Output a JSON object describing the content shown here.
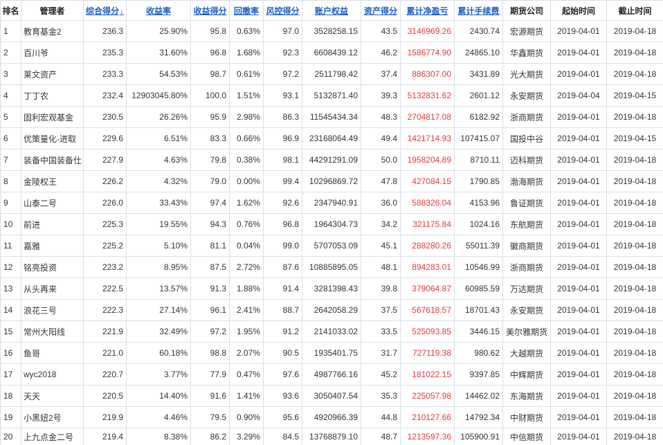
{
  "colors": {
    "text": "#333333",
    "header_text": "#222222",
    "link": "#1a5fc8",
    "sort_arrow": "#e4393c",
    "net_pnl": "#e4393c",
    "grid": "#d8dfe9",
    "background": "#ffffff"
  },
  "table": {
    "headers": {
      "rank": "排名",
      "manager": "管理者",
      "score": "综合得分",
      "return_rate": "收益率",
      "return_score": "收益得分",
      "drawdown": "回撤率",
      "risk_score": "风控得分",
      "equity": "账户权益",
      "asset_score": "资产得分",
      "net_pnl": "累计净盈亏",
      "fees": "累计手续费",
      "broker": "期货公司",
      "start_date": "起始时间",
      "end_date": "截止时间"
    },
    "sort_indicator": "↓",
    "rows": [
      {
        "rank": "1",
        "manager": "教育基金2",
        "score": "236.3",
        "return_rate": "25.90%",
        "return_score": "95.8",
        "drawdown": "0.63%",
        "risk_score": "97.0",
        "equity": "3528258.15",
        "asset_score": "43.5",
        "net_pnl": "3146969.26",
        "fees": "2430.74",
        "broker": "宏源期货",
        "start_date": "2019-04-01",
        "end_date": "2019-04-18"
      },
      {
        "rank": "2",
        "manager": "百川爷",
        "score": "235.3",
        "return_rate": "31.60%",
        "return_score": "96.8",
        "drawdown": "1.68%",
        "risk_score": "92.3",
        "equity": "6608439.12",
        "asset_score": "46.2",
        "net_pnl": "1586774.90",
        "fees": "24865.10",
        "broker": "华鑫期货",
        "start_date": "2019-04-01",
        "end_date": "2019-04-18"
      },
      {
        "rank": "3",
        "manager": "莱文资产",
        "score": "233.3",
        "return_rate": "54.53%",
        "return_score": "98.7",
        "drawdown": "0.61%",
        "risk_score": "97.2",
        "equity": "2511798.42",
        "asset_score": "37.4",
        "net_pnl": "886307.00",
        "fees": "3431.89",
        "broker": "光大期货",
        "start_date": "2019-04-01",
        "end_date": "2019-04-18"
      },
      {
        "rank": "4",
        "manager": "丁丁农",
        "score": "232.4",
        "return_rate": "12903045.80%",
        "return_score": "100.0",
        "drawdown": "1.51%",
        "risk_score": "93.1",
        "equity": "5132871.40",
        "asset_score": "39.3",
        "net_pnl": "5132831.62",
        "fees": "2601.12",
        "broker": "永安期货",
        "start_date": "2019-04-04",
        "end_date": "2019-04-15"
      },
      {
        "rank": "5",
        "manager": "固利宏观基金",
        "score": "230.5",
        "return_rate": "26.26%",
        "return_score": "95.9",
        "drawdown": "2.98%",
        "risk_score": "86.3",
        "equity": "11545434.34",
        "asset_score": "48.3",
        "net_pnl": "2704817.08",
        "fees": "6182.92",
        "broker": "浙商期货",
        "start_date": "2019-04-01",
        "end_date": "2019-04-18"
      },
      {
        "rank": "6",
        "manager": "优策量化-进取",
        "score": "229.6",
        "return_rate": "6.51%",
        "return_score": "83.3",
        "drawdown": "0.66%",
        "risk_score": "96.9",
        "equity": "23168064.49",
        "asset_score": "49.4",
        "net_pnl": "1421714.93",
        "fees": "107415.07",
        "broker": "国投中谷",
        "start_date": "2019-04-01",
        "end_date": "2019-04-15"
      },
      {
        "rank": "7",
        "manager": "装备中国装备仕",
        "score": "227.9",
        "return_rate": "4.63%",
        "return_score": "79.8",
        "drawdown": "0.38%",
        "risk_score": "98.1",
        "equity": "44291291.09",
        "asset_score": "50.0",
        "net_pnl": "1958204.89",
        "fees": "8710.11",
        "broker": "迈科期货",
        "start_date": "2019-04-01",
        "end_date": "2019-04-18"
      },
      {
        "rank": "8",
        "manager": "金陵权王",
        "score": "226.2",
        "return_rate": "4.32%",
        "return_score": "79.0",
        "drawdown": "0.00%",
        "risk_score": "99.4",
        "equity": "10296869.72",
        "asset_score": "47.8",
        "net_pnl": "427084.15",
        "fees": "1790.85",
        "broker": "渤海期货",
        "start_date": "2019-04-01",
        "end_date": "2019-04-18"
      },
      {
        "rank": "9",
        "manager": "山泰二号",
        "score": "226.0",
        "return_rate": "33.43%",
        "return_score": "97.4",
        "drawdown": "1.62%",
        "risk_score": "92.6",
        "equity": "2347940.91",
        "asset_score": "36.0",
        "net_pnl": "588326.04",
        "fees": "4153.96",
        "broker": "鲁证期货",
        "start_date": "2019-04-01",
        "end_date": "2019-04-18"
      },
      {
        "rank": "10",
        "manager": "前进",
        "score": "225.3",
        "return_rate": "19.55%",
        "return_score": "94.3",
        "drawdown": "0.76%",
        "risk_score": "96.8",
        "equity": "1964304.73",
        "asset_score": "34.2",
        "net_pnl": "321175.84",
        "fees": "1024.16",
        "broker": "东航期货",
        "start_date": "2019-04-01",
        "end_date": "2019-04-18"
      },
      {
        "rank": "11",
        "manager": "嘉雅",
        "score": "225.2",
        "return_rate": "5.10%",
        "return_score": "81.1",
        "drawdown": "0.04%",
        "risk_score": "99.0",
        "equity": "5707053.09",
        "asset_score": "45.1",
        "net_pnl": "288280.26",
        "fees": "55011.39",
        "broker": "徽商期货",
        "start_date": "2019-04-01",
        "end_date": "2019-04-18"
      },
      {
        "rank": "12",
        "manager": "铭亮投资",
        "score": "223.2",
        "return_rate": "8.95%",
        "return_score": "87.5",
        "drawdown": "2.72%",
        "risk_score": "87.6",
        "equity": "10885895.05",
        "asset_score": "48.1",
        "net_pnl": "894283.01",
        "fees": "10546.99",
        "broker": "浙商期货",
        "start_date": "2019-04-01",
        "end_date": "2019-04-18"
      },
      {
        "rank": "13",
        "manager": "从头再来",
        "score": "222.5",
        "return_rate": "13.57%",
        "return_score": "91.3",
        "drawdown": "1.88%",
        "risk_score": "91.4",
        "equity": "3281398.43",
        "asset_score": "39.8",
        "net_pnl": "379064.87",
        "fees": "60985.59",
        "broker": "万达期货",
        "start_date": "2019-04-01",
        "end_date": "2019-04-18"
      },
      {
        "rank": "14",
        "manager": "浪花三号",
        "score": "222.3",
        "return_rate": "27.14%",
        "return_score": "96.1",
        "drawdown": "2.41%",
        "risk_score": "88.7",
        "equity": "2642058.29",
        "asset_score": "37.5",
        "net_pnl": "567618.57",
        "fees": "18701.43",
        "broker": "永安期货",
        "start_date": "2019-04-01",
        "end_date": "2019-04-18"
      },
      {
        "rank": "15",
        "manager": "常州大阳线",
        "score": "221.9",
        "return_rate": "32.49%",
        "return_score": "97.2",
        "drawdown": "1.95%",
        "risk_score": "91.2",
        "equity": "2141033.02",
        "asset_score": "33.5",
        "net_pnl": "525093.85",
        "fees": "3446.15",
        "broker": "美尔雅期货",
        "start_date": "2019-04-01",
        "end_date": "2019-04-18"
      },
      {
        "rank": "16",
        "manager": "鱼哥",
        "score": "221.0",
        "return_rate": "60.18%",
        "return_score": "98.8",
        "drawdown": "2.07%",
        "risk_score": "90.5",
        "equity": "1935401.75",
        "asset_score": "31.7",
        "net_pnl": "727119.38",
        "fees": "980.62",
        "broker": "大越期货",
        "start_date": "2019-04-01",
        "end_date": "2019-04-18"
      },
      {
        "rank": "17",
        "manager": "wyc2018",
        "score": "220.7",
        "return_rate": "3.77%",
        "return_score": "77.9",
        "drawdown": "0.47%",
        "risk_score": "97.6",
        "equity": "4987766.16",
        "asset_score": "45.2",
        "net_pnl": "181022.15",
        "fees": "9397.85",
        "broker": "中辉期货",
        "start_date": "2019-04-01",
        "end_date": "2019-04-18"
      },
      {
        "rank": "18",
        "manager": "天天",
        "score": "220.5",
        "return_rate": "14.40%",
        "return_score": "91.6",
        "drawdown": "1.41%",
        "risk_score": "93.6",
        "equity": "3050407.54",
        "asset_score": "35.3",
        "net_pnl": "225057.98",
        "fees": "14462.02",
        "broker": "东海期货",
        "start_date": "2019-04-01",
        "end_date": "2019-04-18"
      },
      {
        "rank": "19",
        "manager": "小黑妞2号",
        "score": "219.9",
        "return_rate": "4.46%",
        "return_score": "79.5",
        "drawdown": "0.90%",
        "risk_score": "95.6",
        "equity": "4920966.39",
        "asset_score": "44.8",
        "net_pnl": "210127.66",
        "fees": "14792.34",
        "broker": "中财期货",
        "start_date": "2019-04-01",
        "end_date": "2019-04-18"
      },
      {
        "rank": "20",
        "manager": "上九点金二号",
        "score": "219.4",
        "return_rate": "8.38%",
        "return_score": "86.2",
        "drawdown": "3.29%",
        "risk_score": "84.5",
        "equity": "13768879.10",
        "asset_score": "48.7",
        "net_pnl": "1213597.36",
        "fees": "105900.91",
        "broker": "中信期货",
        "start_date": "2019-04-01",
        "end_date": "2019-04-18"
      }
    ]
  }
}
